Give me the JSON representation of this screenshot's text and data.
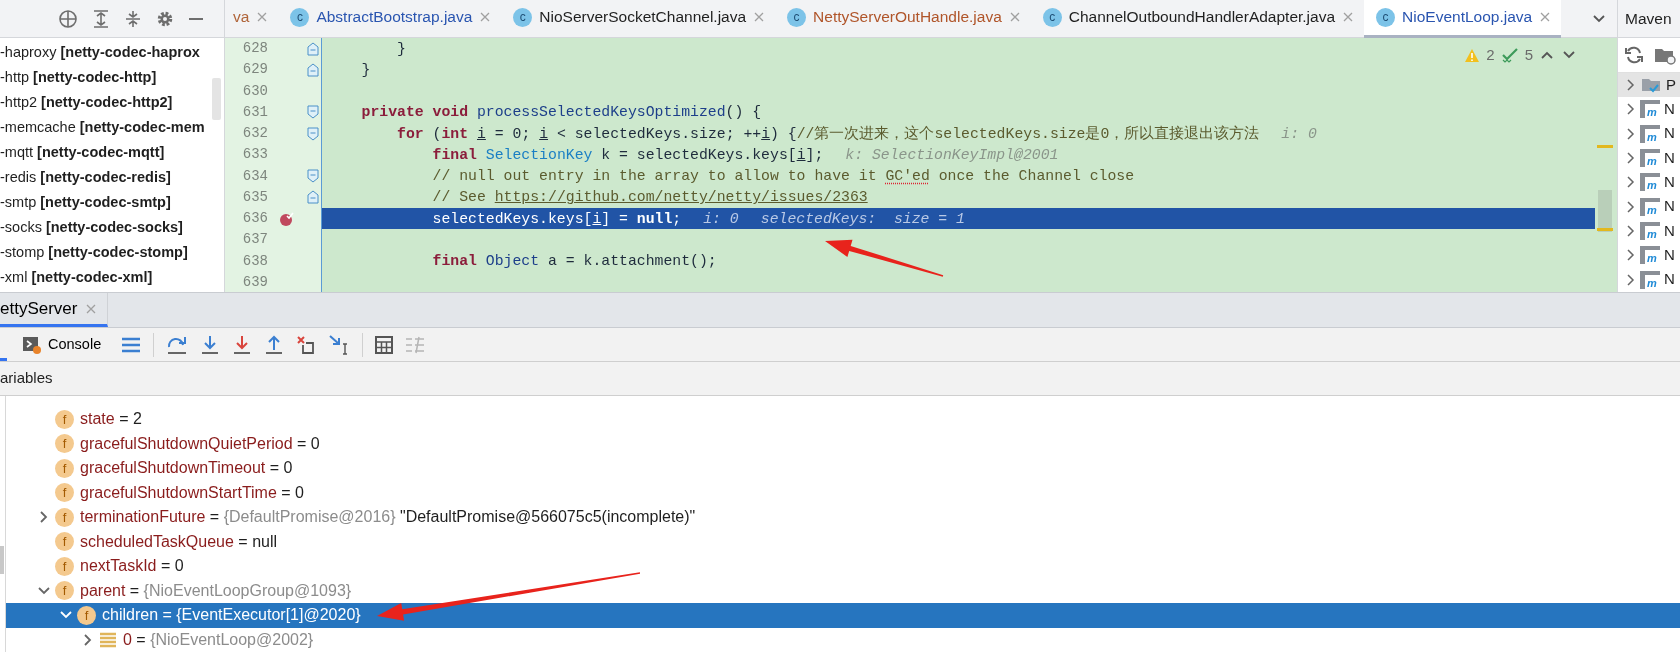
{
  "project_tree": [
    {
      "name": "-haproxy",
      "module": "[netty-codec-haprox"
    },
    {
      "name": "-http",
      "module": "[netty-codec-http]"
    },
    {
      "name": "-http2",
      "module": "[netty-codec-http2]"
    },
    {
      "name": "-memcache",
      "module": "[netty-codec-mem"
    },
    {
      "name": "-mqtt",
      "module": "[netty-codec-mqtt]"
    },
    {
      "name": "-redis",
      "module": "[netty-codec-redis]"
    },
    {
      "name": "-smtp",
      "module": "[netty-codec-smtp]"
    },
    {
      "name": "-socks",
      "module": "[netty-codec-socks]"
    },
    {
      "name": "-stomp",
      "module": "[netty-codec-stomp]"
    },
    {
      "name": "-xml",
      "module": "[netty-codec-xml]"
    }
  ],
  "tabs": [
    {
      "label": "va",
      "color": "#b0653a",
      "selected": false
    },
    {
      "label": "AbstractBootstrap.java",
      "badge": "c",
      "color": "#2a55b0",
      "selected": false
    },
    {
      "label": "NioServerSocketChannel.java",
      "badge": "c",
      "color": "#1f1f1f",
      "selected": false
    },
    {
      "label": "NettyServerOutHandle.java",
      "badge": "c",
      "color": "#b0552a",
      "selected": false
    },
    {
      "label": "ChannelOutboundHandlerAdapter.java",
      "badge": "c",
      "color": "#1f1f1f",
      "selected": false
    },
    {
      "label": "NioEventLoop.java",
      "badge": "c",
      "color": "#2a55b0",
      "selected": true
    }
  ],
  "inspections": {
    "warnings": "2",
    "weak_warnings": "5"
  },
  "lines": [
    {
      "number": "628",
      "kind": "fold_end",
      "breakpoint": false,
      "selected": false,
      "tokens": [
        {
          "kind": "plain",
          "text": "        }"
        }
      ]
    },
    {
      "number": "629",
      "kind": "fold_end",
      "breakpoint": false,
      "selected": false,
      "tokens": [
        {
          "kind": "plain",
          "text": "    }"
        }
      ]
    },
    {
      "number": "630",
      "kind": "plain",
      "breakpoint": false,
      "selected": false
    },
    {
      "number": "631",
      "kind": "fold_start",
      "breakpoint": false,
      "selected": false,
      "tokens": [
        {
          "kind": "kw",
          "text": "    private void "
        },
        {
          "kind": "method",
          "text": "processSelectedKeysOptimized"
        },
        {
          "kind": "plain",
          "text": "() {"
        }
      ]
    },
    {
      "number": "632",
      "kind": "fold_start",
      "breakpoint": false,
      "selected": false,
      "tokens": [
        {
          "kind": "kw",
          "text": "        for"
        },
        {
          "kind": "plain",
          "text": " ("
        },
        {
          "kind": "kw",
          "text": "int "
        },
        {
          "kind": "var",
          "text": "i"
        },
        {
          "kind": "plain",
          "text": " = 0; "
        },
        {
          "kind": "var",
          "text": "i"
        },
        {
          "kind": "plain",
          "text": " < selectedKeys.size; ++"
        },
        {
          "kind": "var",
          "text": "i"
        },
        {
          "kind": "plain",
          "text": ") {"
        },
        {
          "kind": "comment",
          "text": "//第一次进来，这个selectedKeys.size是0，所以直接退出该方法"
        }
      ],
      "hints": [
        "i: 0"
      ]
    },
    {
      "number": "633",
      "kind": "plain",
      "breakpoint": false,
      "selected": false,
      "tokens": [
        {
          "kind": "kw",
          "text": "            final "
        },
        {
          "kind": "type",
          "text": "SelectionKey"
        },
        {
          "kind": "plain",
          "text": " k = selectedKeys.keys["
        },
        {
          "kind": "var",
          "text": "i"
        },
        {
          "kind": "plain",
          "text": "];"
        }
      ],
      "hints": [
        "k: SelectionKeyImpl@2001"
      ]
    },
    {
      "number": "634",
      "kind": "fold_start",
      "breakpoint": false,
      "selected": false,
      "tokens": [
        {
          "kind": "comment",
          "text": "            // null out entry in the array to allow to have it "
        },
        {
          "kind": "typo",
          "text": "GC'ed"
        },
        {
          "kind": "comment",
          "text": " once the Channel close"
        }
      ]
    },
    {
      "number": "635",
      "kind": "fold_end",
      "breakpoint": false,
      "selected": false,
      "tokens": [
        {
          "kind": "comment",
          "text": "            // See "
        },
        {
          "kind": "link",
          "text": "https://github.com/netty/netty/issues/2363"
        }
      ]
    },
    {
      "number": "636",
      "kind": "plain",
      "breakpoint": true,
      "selected": true,
      "tokens": [
        {
          "kind": "plain",
          "text": "            selectedKeys.keys["
        },
        {
          "kind": "var",
          "text": "i"
        },
        {
          "kind": "plain",
          "text": "] = "
        },
        {
          "kind": "kw",
          "text": "null"
        },
        {
          "kind": "plain",
          "text": ";"
        }
      ],
      "hints": [
        "i: 0",
        "selectedKeys:  size = 1"
      ]
    },
    {
      "number": "637",
      "kind": "plain",
      "breakpoint": false,
      "selected": false
    },
    {
      "number": "638",
      "kind": "plain",
      "breakpoint": false,
      "selected": false,
      "tokens": [
        {
          "kind": "kw",
          "text": "            final "
        },
        {
          "kind": "class",
          "text": "Object"
        },
        {
          "kind": "plain",
          "text": " a = k.attachment();"
        }
      ]
    },
    {
      "number": "639",
      "kind": "plain",
      "breakpoint": false,
      "selected": false
    }
  ],
  "maven": {
    "title": "Maven",
    "items": [
      {
        "label": "P",
        "kind": "project",
        "selected": true
      },
      {
        "label": "N",
        "kind": "module",
        "badge": "m",
        "selected": false
      },
      {
        "label": "N",
        "kind": "module",
        "badge": "m",
        "selected": false
      },
      {
        "label": "N",
        "kind": "module",
        "badge": "m",
        "selected": false
      },
      {
        "label": "N",
        "kind": "module",
        "badge": "m",
        "selected": false
      },
      {
        "label": "N",
        "kind": "module",
        "badge": "m",
        "selected": false
      },
      {
        "label": "N",
        "kind": "module",
        "badge": "m",
        "selected": false
      },
      {
        "label": "N",
        "kind": "module",
        "badge": "m",
        "selected": false
      },
      {
        "label": "N",
        "kind": "module",
        "badge": "m",
        "selected": false
      }
    ]
  },
  "debug": {
    "session_tabs": [
      {
        "label": "ettyServer",
        "selected": true
      }
    ],
    "console_button": "Console",
    "variables_title": "ariables",
    "variables": [
      {
        "kind": "field",
        "badge": "f",
        "name": "state",
        "eq": "=",
        "value": "2",
        "selected": false
      },
      {
        "kind": "field",
        "badge": "f",
        "name": "gracefulShutdownQuietPeriod",
        "eq": "=",
        "value": "0",
        "selected": false
      },
      {
        "kind": "field",
        "badge": "f",
        "name": "gracefulShutdownTimeout",
        "eq": "=",
        "value": "0",
        "selected": false
      },
      {
        "kind": "field",
        "badge": "f",
        "name": "gracefulShutdownStartTime",
        "eq": "=",
        "value": "0",
        "selected": false
      },
      {
        "kind": "field",
        "badge": "f",
        "name": "terminationFuture",
        "eq": "=",
        "ref": "{DefaultPromise@2016}",
        "value": "\"DefaultPromise@566075c5(incomplete)\"",
        "expanded": false,
        "selected": false
      },
      {
        "kind": "field",
        "badge": "f",
        "name": "scheduledTaskQueue",
        "eq": "=",
        "value": "null",
        "selected": false
      },
      {
        "kind": "field",
        "badge": "f",
        "name": "nextTaskId",
        "eq": "=",
        "value": "0",
        "selected": false
      },
      {
        "kind": "field",
        "badge": "f",
        "name": "parent",
        "eq": "=",
        "ref": "{NioEventLoopGroup@1093}",
        "expanded": true,
        "selected": false,
        "children": [
          {
            "kind": "field",
            "badge": "f",
            "name": "children",
            "eq": "=",
            "ref": "{EventExecutor[1]@2020}",
            "expanded": true,
            "selected": true,
            "children": [
              {
                "kind": "element",
                "name": "0",
                "eq": "=",
                "ref": "{NioEventLoop@2002}",
                "expanded": false,
                "selected": false
              }
            ]
          }
        ]
      }
    ]
  }
}
